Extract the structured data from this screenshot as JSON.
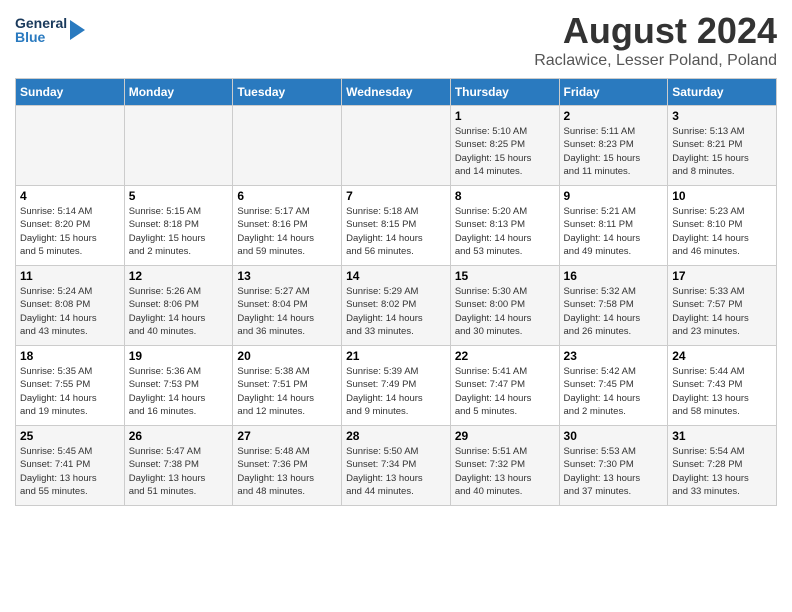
{
  "logo": {
    "line1": "General",
    "line2": "Blue"
  },
  "title": "August 2024",
  "subtitle": "Raclawice, Lesser Poland, Poland",
  "header_days": [
    "Sunday",
    "Monday",
    "Tuesday",
    "Wednesday",
    "Thursday",
    "Friday",
    "Saturday"
  ],
  "weeks": [
    [
      {
        "day": "",
        "info": ""
      },
      {
        "day": "",
        "info": ""
      },
      {
        "day": "",
        "info": ""
      },
      {
        "day": "",
        "info": ""
      },
      {
        "day": "1",
        "info": "Sunrise: 5:10 AM\nSunset: 8:25 PM\nDaylight: 15 hours\nand 14 minutes."
      },
      {
        "day": "2",
        "info": "Sunrise: 5:11 AM\nSunset: 8:23 PM\nDaylight: 15 hours\nand 11 minutes."
      },
      {
        "day": "3",
        "info": "Sunrise: 5:13 AM\nSunset: 8:21 PM\nDaylight: 15 hours\nand 8 minutes."
      }
    ],
    [
      {
        "day": "4",
        "info": "Sunrise: 5:14 AM\nSunset: 8:20 PM\nDaylight: 15 hours\nand 5 minutes."
      },
      {
        "day": "5",
        "info": "Sunrise: 5:15 AM\nSunset: 8:18 PM\nDaylight: 15 hours\nand 2 minutes."
      },
      {
        "day": "6",
        "info": "Sunrise: 5:17 AM\nSunset: 8:16 PM\nDaylight: 14 hours\nand 59 minutes."
      },
      {
        "day": "7",
        "info": "Sunrise: 5:18 AM\nSunset: 8:15 PM\nDaylight: 14 hours\nand 56 minutes."
      },
      {
        "day": "8",
        "info": "Sunrise: 5:20 AM\nSunset: 8:13 PM\nDaylight: 14 hours\nand 53 minutes."
      },
      {
        "day": "9",
        "info": "Sunrise: 5:21 AM\nSunset: 8:11 PM\nDaylight: 14 hours\nand 49 minutes."
      },
      {
        "day": "10",
        "info": "Sunrise: 5:23 AM\nSunset: 8:10 PM\nDaylight: 14 hours\nand 46 minutes."
      }
    ],
    [
      {
        "day": "11",
        "info": "Sunrise: 5:24 AM\nSunset: 8:08 PM\nDaylight: 14 hours\nand 43 minutes."
      },
      {
        "day": "12",
        "info": "Sunrise: 5:26 AM\nSunset: 8:06 PM\nDaylight: 14 hours\nand 40 minutes."
      },
      {
        "day": "13",
        "info": "Sunrise: 5:27 AM\nSunset: 8:04 PM\nDaylight: 14 hours\nand 36 minutes."
      },
      {
        "day": "14",
        "info": "Sunrise: 5:29 AM\nSunset: 8:02 PM\nDaylight: 14 hours\nand 33 minutes."
      },
      {
        "day": "15",
        "info": "Sunrise: 5:30 AM\nSunset: 8:00 PM\nDaylight: 14 hours\nand 30 minutes."
      },
      {
        "day": "16",
        "info": "Sunrise: 5:32 AM\nSunset: 7:58 PM\nDaylight: 14 hours\nand 26 minutes."
      },
      {
        "day": "17",
        "info": "Sunrise: 5:33 AM\nSunset: 7:57 PM\nDaylight: 14 hours\nand 23 minutes."
      }
    ],
    [
      {
        "day": "18",
        "info": "Sunrise: 5:35 AM\nSunset: 7:55 PM\nDaylight: 14 hours\nand 19 minutes."
      },
      {
        "day": "19",
        "info": "Sunrise: 5:36 AM\nSunset: 7:53 PM\nDaylight: 14 hours\nand 16 minutes."
      },
      {
        "day": "20",
        "info": "Sunrise: 5:38 AM\nSunset: 7:51 PM\nDaylight: 14 hours\nand 12 minutes."
      },
      {
        "day": "21",
        "info": "Sunrise: 5:39 AM\nSunset: 7:49 PM\nDaylight: 14 hours\nand 9 minutes."
      },
      {
        "day": "22",
        "info": "Sunrise: 5:41 AM\nSunset: 7:47 PM\nDaylight: 14 hours\nand 5 minutes."
      },
      {
        "day": "23",
        "info": "Sunrise: 5:42 AM\nSunset: 7:45 PM\nDaylight: 14 hours\nand 2 minutes."
      },
      {
        "day": "24",
        "info": "Sunrise: 5:44 AM\nSunset: 7:43 PM\nDaylight: 13 hours\nand 58 minutes."
      }
    ],
    [
      {
        "day": "25",
        "info": "Sunrise: 5:45 AM\nSunset: 7:41 PM\nDaylight: 13 hours\nand 55 minutes."
      },
      {
        "day": "26",
        "info": "Sunrise: 5:47 AM\nSunset: 7:38 PM\nDaylight: 13 hours\nand 51 minutes."
      },
      {
        "day": "27",
        "info": "Sunrise: 5:48 AM\nSunset: 7:36 PM\nDaylight: 13 hours\nand 48 minutes."
      },
      {
        "day": "28",
        "info": "Sunrise: 5:50 AM\nSunset: 7:34 PM\nDaylight: 13 hours\nand 44 minutes."
      },
      {
        "day": "29",
        "info": "Sunrise: 5:51 AM\nSunset: 7:32 PM\nDaylight: 13 hours\nand 40 minutes."
      },
      {
        "day": "30",
        "info": "Sunrise: 5:53 AM\nSunset: 7:30 PM\nDaylight: 13 hours\nand 37 minutes."
      },
      {
        "day": "31",
        "info": "Sunrise: 5:54 AM\nSunset: 7:28 PM\nDaylight: 13 hours\nand 33 minutes."
      }
    ]
  ]
}
